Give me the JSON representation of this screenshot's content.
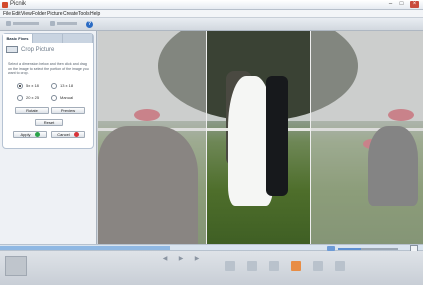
{
  "window": {
    "title": "Picnik",
    "controls": {
      "minimize": "–",
      "maximize": "□",
      "close": "×"
    }
  },
  "menu": [
    "File",
    "Edit",
    "View",
    "Folder",
    "Picture",
    "Create",
    "Tools",
    "Help"
  ],
  "toolbar": {
    "help_icon": "?"
  },
  "panel": {
    "tabs": [
      "Basic Fixes",
      "",
      ""
    ],
    "title": "Crop Picture",
    "description": "Select a dimension below and then click and drag on the image to select the portion of the image you want to crop.",
    "options": [
      {
        "label": "5x x 18",
        "selected": true
      },
      {
        "label": "13 x 18",
        "selected": false
      },
      {
        "label": "20 x 25",
        "selected": false
      },
      {
        "label": "Manual",
        "selected": false
      }
    ],
    "rotate_label": "Rotate",
    "preview_label": "Preview",
    "reset_label": "Reset",
    "apply_label": "Apply",
    "cancel_label": "Cancel",
    "apply_color": "#2aa34a",
    "cancel_color": "#d8343a"
  },
  "icons": {
    "app": "app-icon",
    "help": "help-icon",
    "crop": "crop-icon",
    "apply": "check-icon",
    "cancel": "cancel-icon"
  },
  "navigation": {
    "previous": "◀",
    "play": "▶",
    "next": "▶"
  },
  "zoom": {
    "level": 0.38
  }
}
